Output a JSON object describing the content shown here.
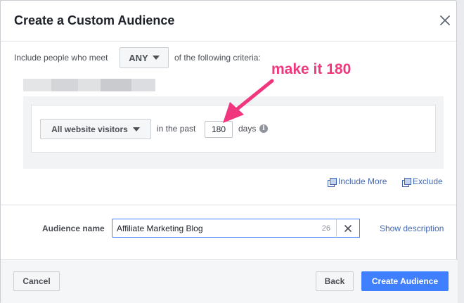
{
  "dialog": {
    "title": "Create a Custom Audience"
  },
  "criteria": {
    "prefix": "Include people who meet",
    "match_value": "ANY",
    "suffix": "of the following criteria:"
  },
  "rule": {
    "source_value": "All website visitors",
    "in_the_past_label": "in the past",
    "days_value": "180",
    "days_label": "days",
    "info_glyph": "i"
  },
  "annotation": {
    "text": "make it 180",
    "color": "#f0377d"
  },
  "links": {
    "include_more": "Include More",
    "exclude": "Exclude"
  },
  "audience": {
    "label": "Audience name",
    "value": "Affiliate Marketing Blog",
    "char_count": "26",
    "show_description": "Show description"
  },
  "footer": {
    "cancel": "Cancel",
    "back": "Back",
    "create": "Create Audience"
  },
  "colors": {
    "accent": "#4080ff",
    "link": "#4267b2"
  }
}
